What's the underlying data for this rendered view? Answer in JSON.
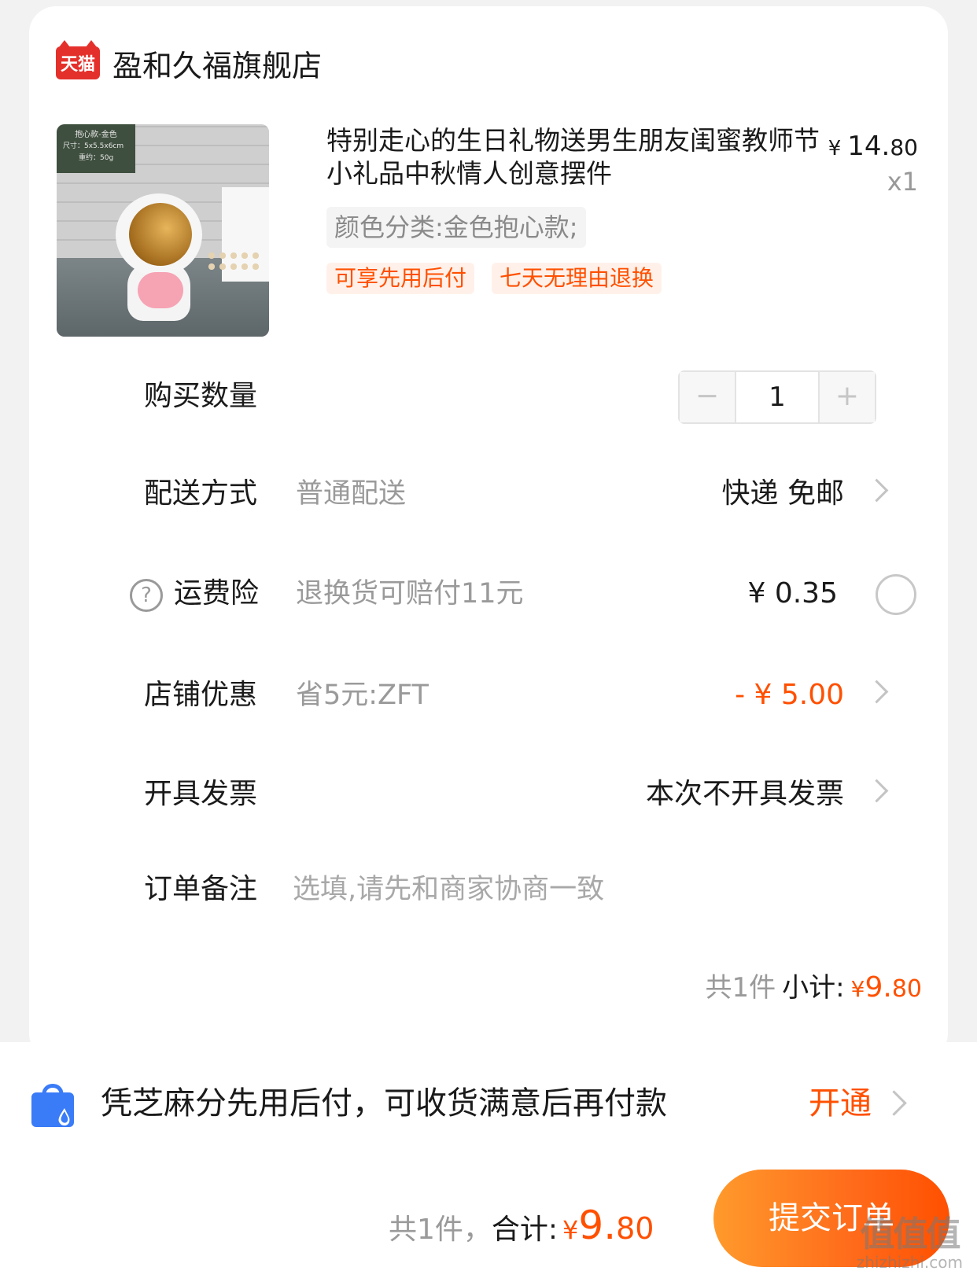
{
  "store": {
    "logo_text": "天猫",
    "name": "盈和久福旗舰店"
  },
  "product": {
    "image_label": [
      "抱心款-金色",
      "尺寸：5x5.5x6cm",
      "重约：50g"
    ],
    "title": "特别走心的生日礼物送男生朋友闺蜜教师节小礼品中秋情人创意摆件",
    "price_yen": "¥",
    "price_int": "14.",
    "price_dec": "80",
    "quantity_label": "x1",
    "variant": "颜色分类:金色抱心款;",
    "tags": [
      "可享先用后付",
      "七天无理由退换"
    ]
  },
  "rows": {
    "quantity": {
      "label": "购买数量",
      "minus": "−",
      "value": "1",
      "plus": "+"
    },
    "delivery": {
      "label": "配送方式",
      "sub": "普通配送",
      "value": "快递 免邮"
    },
    "insurance": {
      "icon": "?",
      "label": "运费险",
      "sub": "退换货可赔付11元",
      "value": "¥ 0.35"
    },
    "discount": {
      "label": "店铺优惠",
      "sub": "省5元:ZFT",
      "value": "- ¥ 5.00"
    },
    "invoice": {
      "label": "开具发票",
      "value": "本次不开具发票"
    },
    "note": {
      "label": "订单备注",
      "placeholder": "选填,请先和商家协商一致"
    }
  },
  "subtotal": {
    "count": "共1件",
    "label": "小计:",
    "yen": "¥",
    "int": "9.",
    "dec": "80"
  },
  "credit_pay": {
    "text": "凭芝麻分先用后付，可收货满意后再付款",
    "action": "开通"
  },
  "footer": {
    "count": "共1件，",
    "label": "合计:",
    "yen": "¥",
    "int": "9.",
    "dec": "80",
    "submit": "提交订单"
  },
  "watermark": {
    "logo": "值值值",
    "text": "zhizhizhi.com"
  },
  "colors": {
    "accent": "#ff5000",
    "tmall_red": "#e4302b",
    "tag_bg": "#fff1ea",
    "bag_blue": "#3a7bf7"
  }
}
